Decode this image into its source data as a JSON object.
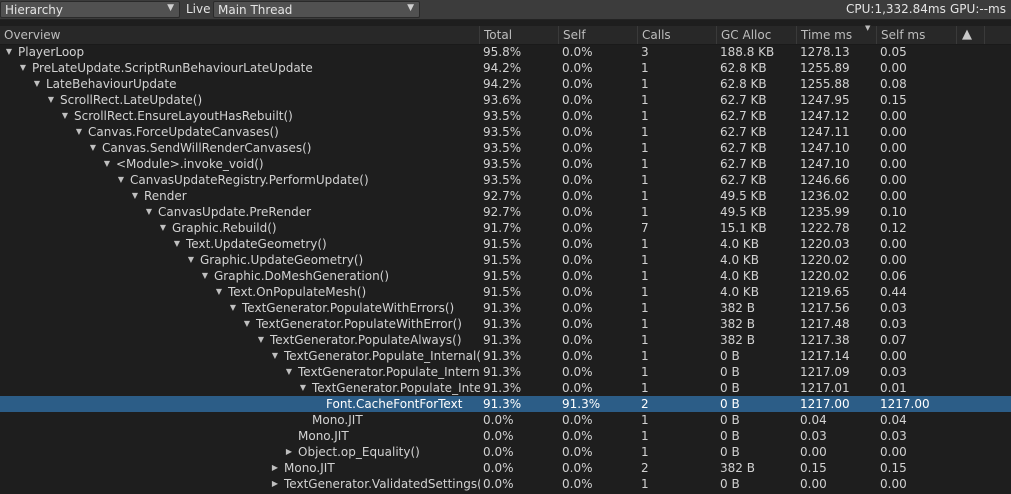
{
  "toolbar": {
    "view_mode": "Hierarchy",
    "live_label": "Live",
    "thread": "Main Thread",
    "cpu": "CPU:1,332.84ms",
    "gpu": "GPU:--ms"
  },
  "columns": [
    "Overview",
    "Total",
    "Self",
    "Calls",
    "GC Alloc",
    "Time ms",
    "Self ms"
  ],
  "rows": [
    {
      "name": "PlayerLoop",
      "depth": 0,
      "expander": "open",
      "total": "95.8%",
      "self": "0.0%",
      "calls": "3",
      "gc": "188.8 KB",
      "time": "1278.13",
      "selfms": "0.05"
    },
    {
      "name": "PreLateUpdate.ScriptRunBehaviourLateUpdate",
      "depth": 1,
      "expander": "open",
      "total": "94.2%",
      "self": "0.0%",
      "calls": "1",
      "gc": "62.8 KB",
      "time": "1255.89",
      "selfms": "0.00"
    },
    {
      "name": "LateBehaviourUpdate",
      "depth": 2,
      "expander": "open",
      "total": "94.2%",
      "self": "0.0%",
      "calls": "1",
      "gc": "62.8 KB",
      "time": "1255.88",
      "selfms": "0.08"
    },
    {
      "name": "ScrollRect.LateUpdate()",
      "depth": 3,
      "expander": "open",
      "total": "93.6%",
      "self": "0.0%",
      "calls": "1",
      "gc": "62.7 KB",
      "time": "1247.95",
      "selfms": "0.15"
    },
    {
      "name": "ScrollRect.EnsureLayoutHasRebuilt()",
      "depth": 4,
      "expander": "open",
      "total": "93.5%",
      "self": "0.0%",
      "calls": "1",
      "gc": "62.7 KB",
      "time": "1247.12",
      "selfms": "0.00"
    },
    {
      "name": "Canvas.ForceUpdateCanvases()",
      "depth": 5,
      "expander": "open",
      "total": "93.5%",
      "self": "0.0%",
      "calls": "1",
      "gc": "62.7 KB",
      "time": "1247.11",
      "selfms": "0.00"
    },
    {
      "name": "Canvas.SendWillRenderCanvases()",
      "depth": 6,
      "expander": "open",
      "total": "93.5%",
      "self": "0.0%",
      "calls": "1",
      "gc": "62.7 KB",
      "time": "1247.10",
      "selfms": "0.00"
    },
    {
      "name": "<Module>.invoke_void()",
      "depth": 7,
      "expander": "open",
      "total": "93.5%",
      "self": "0.0%",
      "calls": "1",
      "gc": "62.7 KB",
      "time": "1247.10",
      "selfms": "0.00"
    },
    {
      "name": "CanvasUpdateRegistry.PerformUpdate()",
      "depth": 8,
      "expander": "open",
      "total": "93.5%",
      "self": "0.0%",
      "calls": "1",
      "gc": "62.7 KB",
      "time": "1246.66",
      "selfms": "0.00"
    },
    {
      "name": "Render",
      "depth": 9,
      "expander": "open",
      "total": "92.7%",
      "self": "0.0%",
      "calls": "1",
      "gc": "49.5 KB",
      "time": "1236.02",
      "selfms": "0.00"
    },
    {
      "name": "CanvasUpdate.PreRender",
      "depth": 10,
      "expander": "open",
      "total": "92.7%",
      "self": "0.0%",
      "calls": "1",
      "gc": "49.5 KB",
      "time": "1235.99",
      "selfms": "0.10"
    },
    {
      "name": "Graphic.Rebuild()",
      "depth": 11,
      "expander": "open",
      "total": "91.7%",
      "self": "0.0%",
      "calls": "7",
      "gc": "15.1 KB",
      "time": "1222.78",
      "selfms": "0.12"
    },
    {
      "name": "Text.UpdateGeometry()",
      "depth": 12,
      "expander": "open",
      "total": "91.5%",
      "self": "0.0%",
      "calls": "1",
      "gc": "4.0 KB",
      "time": "1220.03",
      "selfms": "0.00"
    },
    {
      "name": "Graphic.UpdateGeometry()",
      "depth": 13,
      "expander": "open",
      "total": "91.5%",
      "self": "0.0%",
      "calls": "1",
      "gc": "4.0 KB",
      "time": "1220.02",
      "selfms": "0.00"
    },
    {
      "name": "Graphic.DoMeshGeneration()",
      "depth": 14,
      "expander": "open",
      "total": "91.5%",
      "self": "0.0%",
      "calls": "1",
      "gc": "4.0 KB",
      "time": "1220.02",
      "selfms": "0.06"
    },
    {
      "name": "Text.OnPopulateMesh()",
      "depth": 15,
      "expander": "open",
      "total": "91.5%",
      "self": "0.0%",
      "calls": "1",
      "gc": "4.0 KB",
      "time": "1219.65",
      "selfms": "0.44"
    },
    {
      "name": "TextGenerator.PopulateWithErrors()",
      "depth": 16,
      "expander": "open",
      "total": "91.3%",
      "self": "0.0%",
      "calls": "1",
      "gc": "382 B",
      "time": "1217.56",
      "selfms": "0.03"
    },
    {
      "name": "TextGenerator.PopulateWithError()",
      "depth": 17,
      "expander": "open",
      "total": "91.3%",
      "self": "0.0%",
      "calls": "1",
      "gc": "382 B",
      "time": "1217.48",
      "selfms": "0.03"
    },
    {
      "name": "TextGenerator.PopulateAlways()",
      "depth": 18,
      "expander": "open",
      "total": "91.3%",
      "self": "0.0%",
      "calls": "1",
      "gc": "382 B",
      "time": "1217.38",
      "selfms": "0.07"
    },
    {
      "name": "TextGenerator.Populate_Internal()",
      "depth": 19,
      "expander": "open",
      "total": "91.3%",
      "self": "0.0%",
      "calls": "1",
      "gc": "0 B",
      "time": "1217.14",
      "selfms": "0.00"
    },
    {
      "name": "TextGenerator.Populate_Interna",
      "depth": 20,
      "expander": "open",
      "total": "91.3%",
      "self": "0.0%",
      "calls": "1",
      "gc": "0 B",
      "time": "1217.09",
      "selfms": "0.03"
    },
    {
      "name": "TextGenerator.Populate_Inter",
      "depth": 21,
      "expander": "open",
      "total": "91.3%",
      "self": "0.0%",
      "calls": "1",
      "gc": "0 B",
      "time": "1217.01",
      "selfms": "0.01"
    },
    {
      "name": "Font.CacheFontForText",
      "depth": 22,
      "expander": "none",
      "selected": true,
      "total": "91.3%",
      "self": "91.3%",
      "calls": "2",
      "gc": "0 B",
      "time": "1217.00",
      "selfms": "1217.00"
    },
    {
      "name": "Mono.JIT",
      "depth": 21,
      "expander": "none",
      "total": "0.0%",
      "self": "0.0%",
      "calls": "1",
      "gc": "0 B",
      "time": "0.04",
      "selfms": "0.04"
    },
    {
      "name": "Mono.JIT",
      "depth": 20,
      "expander": "none",
      "total": "0.0%",
      "self": "0.0%",
      "calls": "1",
      "gc": "0 B",
      "time": "0.03",
      "selfms": "0.03"
    },
    {
      "name": "Object.op_Equality()",
      "depth": 20,
      "expander": "closed",
      "total": "0.0%",
      "self": "0.0%",
      "calls": "1",
      "gc": "0 B",
      "time": "0.00",
      "selfms": "0.00"
    },
    {
      "name": "Mono.JIT",
      "depth": 19,
      "expander": "closed",
      "total": "0.0%",
      "self": "0.0%",
      "calls": "2",
      "gc": "382 B",
      "time": "0.15",
      "selfms": "0.15"
    },
    {
      "name": "TextGenerator.ValidatedSettings()",
      "depth": 19,
      "expander": "closed",
      "total": "0.0%",
      "self": "0.0%",
      "calls": "1",
      "gc": "0 B",
      "time": "0.00",
      "selfms": "0.00"
    }
  ]
}
